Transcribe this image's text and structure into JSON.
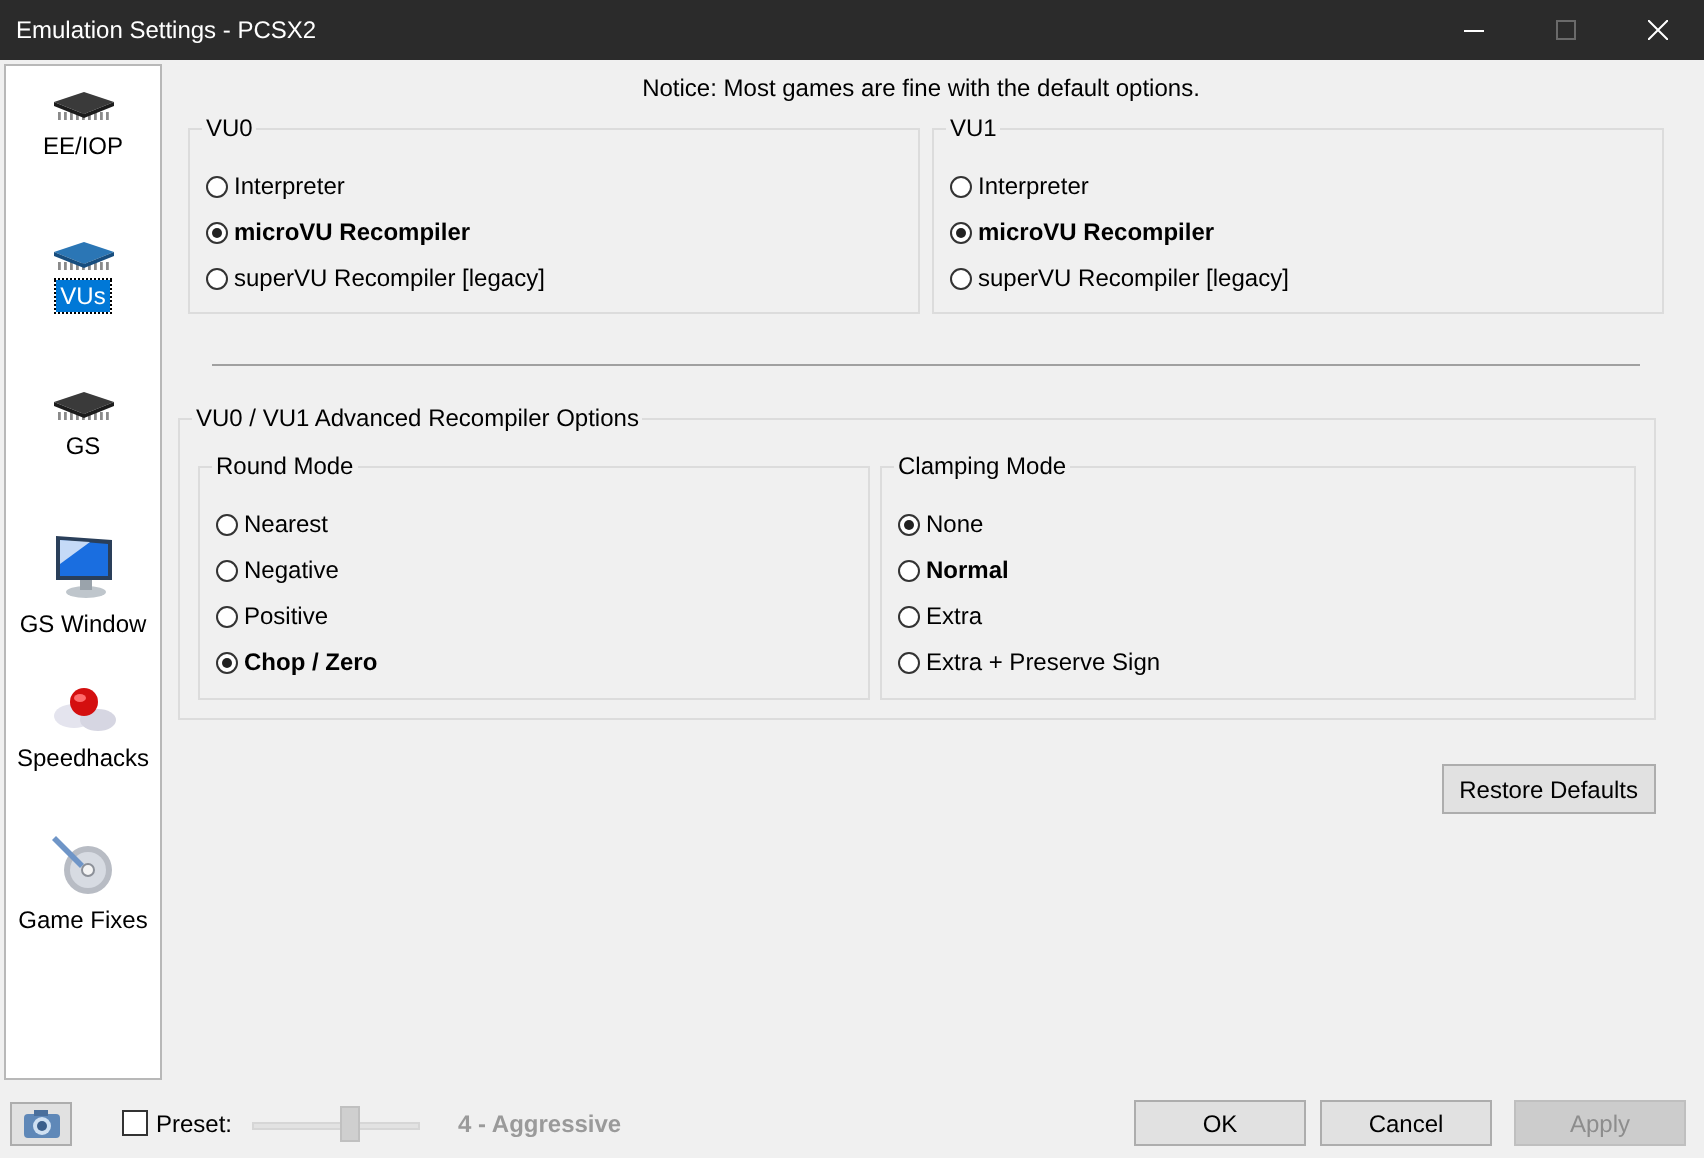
{
  "window": {
    "title": "Emulation Settings - PCSX2",
    "controls": [
      {
        "kind": "minimize",
        "disabled": false
      },
      {
        "kind": "maximize",
        "disabled": true
      },
      {
        "kind": "close",
        "disabled": false
      }
    ]
  },
  "sidebar": {
    "items": [
      {
        "label": "EE/IOP",
        "kind": "chip-dark",
        "selected": false
      },
      {
        "label": "VUs",
        "kind": "chip-blue",
        "selected": true
      },
      {
        "label": "GS",
        "kind": "chip-dark",
        "selected": false
      },
      {
        "label": "GS Window",
        "kind": "monitor",
        "selected": false
      },
      {
        "label": "Speedhacks",
        "kind": "pills",
        "selected": false
      },
      {
        "label": "Game Fixes",
        "kind": "disc",
        "selected": false
      }
    ]
  },
  "notice": "Notice: Most games are fine with the default options.",
  "vu_groups": [
    {
      "title": "VU0",
      "options": [
        {
          "label": "Interpreter",
          "selected": false,
          "default": false
        },
        {
          "label": "microVU Recompiler",
          "selected": true,
          "default": true
        },
        {
          "label": "superVU Recompiler [legacy]",
          "selected": false,
          "default": false
        }
      ]
    },
    {
      "title": "VU1",
      "options": [
        {
          "label": "Interpreter",
          "selected": false,
          "default": false
        },
        {
          "label": "microVU Recompiler",
          "selected": true,
          "default": true
        },
        {
          "label": "superVU Recompiler [legacy]",
          "selected": false,
          "default": false
        }
      ]
    }
  ],
  "advanced": {
    "title": "VU0 / VU1 Advanced Recompiler Options",
    "groups": [
      {
        "title": "Round Mode",
        "options": [
          {
            "label": "Nearest",
            "selected": false,
            "default": false
          },
          {
            "label": "Negative",
            "selected": false,
            "default": false
          },
          {
            "label": "Positive",
            "selected": false,
            "default": false
          },
          {
            "label": "Chop / Zero",
            "selected": true,
            "default": true
          }
        ]
      },
      {
        "title": "Clamping Mode",
        "options": [
          {
            "label": "None",
            "selected": true,
            "default": false
          },
          {
            "label": "Normal",
            "selected": false,
            "default": true
          },
          {
            "label": "Extra",
            "selected": false,
            "default": false
          },
          {
            "label": "Extra + Preserve Sign",
            "selected": false,
            "default": false
          }
        ]
      }
    ]
  },
  "restore_button": "Restore Defaults",
  "bottom_bar": {
    "preset": {
      "label": "Preset:",
      "checked": false
    },
    "slider": {
      "level": 0.58,
      "disabled": true
    },
    "preset_value": {
      "text": "4 - Aggressive",
      "disabled": true
    },
    "buttons": [
      {
        "label": "OK",
        "disabled": false
      },
      {
        "label": "Cancel",
        "disabled": false
      },
      {
        "label": "Apply",
        "disabled": true
      }
    ]
  }
}
